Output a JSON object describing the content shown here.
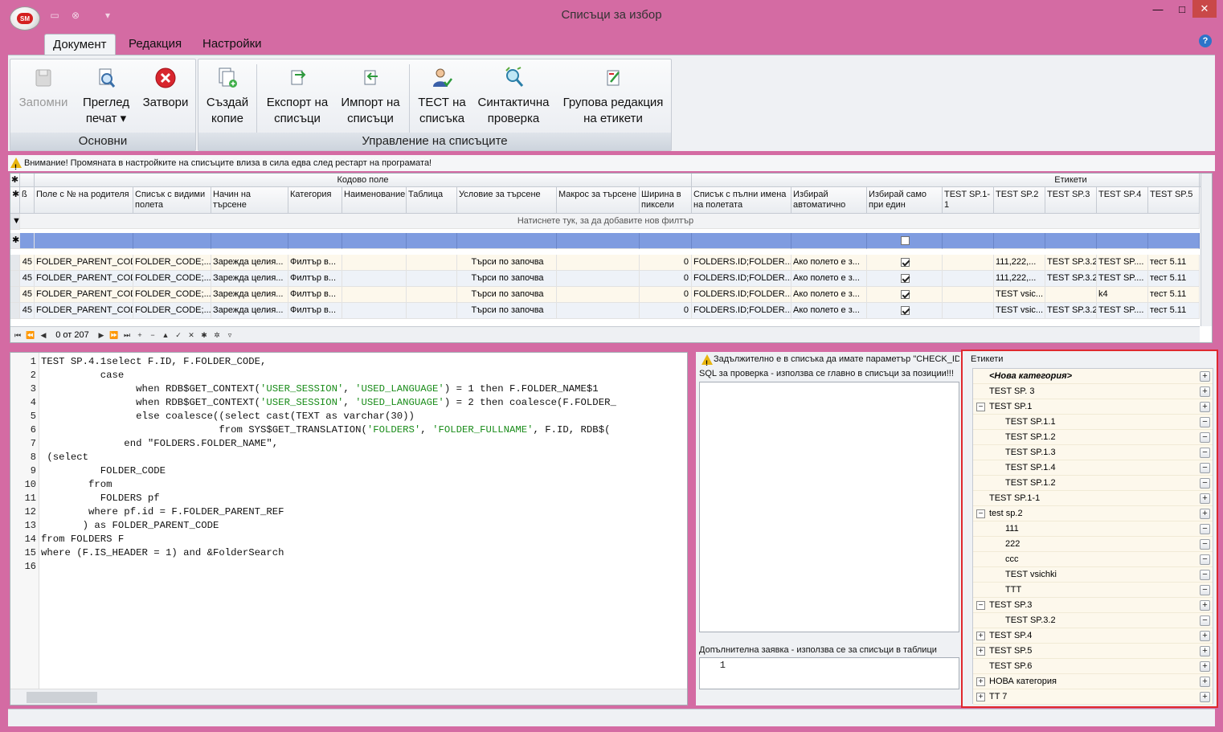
{
  "window": {
    "title": "Списъци за избор",
    "app_logo": "SM"
  },
  "ribbon_tabs": [
    "Документ",
    "Редакция",
    "Настройки"
  ],
  "ribbon": {
    "group1": {
      "label": "Основни",
      "buttons": [
        {
          "l1": "Запомни",
          "l2": "",
          "icon": "save-icon",
          "disabled": true
        },
        {
          "l1": "Преглед",
          "l2": "печат ▾",
          "icon": "print-preview-icon"
        },
        {
          "l1": "Затвори",
          "l2": "",
          "icon": "close-circle-icon"
        }
      ]
    },
    "group2": {
      "label": "Управление на списъците",
      "buttons": [
        {
          "l1": "Създай",
          "l2": "копие",
          "icon": "copy-icon"
        },
        {
          "l1": "Експорт на",
          "l2": "списъци",
          "icon": "export-icon"
        },
        {
          "l1": "Импорт на",
          "l2": "списъци",
          "icon": "import-icon"
        },
        {
          "l1": "ТЕСТ на",
          "l2": "списъка",
          "icon": "test-user-icon"
        },
        {
          "l1": "Синтактична",
          "l2": "проверка",
          "icon": "syntax-check-icon"
        },
        {
          "l1": "Групова редакция",
          "l2": "на етикети",
          "icon": "group-edit-icon"
        }
      ]
    }
  },
  "warning": "Внимание! Промяната в настройките на списъците влиза в сила едва след рестарт на програмата!",
  "grid": {
    "bands": {
      "code_field": "Кодово поле",
      "labels": "Етикети"
    },
    "columns": [
      "Поле с № на родителя",
      "Списък с видими полета",
      "Начин на търсене",
      "Категория",
      "Наименование",
      "Таблица",
      "Условие за търсене",
      "Макрос за търсене",
      "Ширина в пиксели",
      "Списък с пълни имена на полетата",
      "Избирай автоматично",
      "Избирай само при един елемент",
      "TEST SP.1-1",
      "TEST SP.2",
      "TEST SP.3",
      "TEST SP.4",
      "TEST SP.5"
    ],
    "filter_hint": "Натиснете тук, за да добавите нов филтър",
    "rows": [
      {
        "id": "45",
        "c": [
          "FOLDER_PARENT_CODE",
          "FOLDER_CODE;...",
          "Зарежда целия...",
          "Филтър в...",
          "",
          "",
          "Търси по започва",
          "",
          "0",
          "FOLDERS.ID;FOLDER...",
          "Ако полето е з...",
          "",
          "111,222,...",
          "TEST SP.3.2",
          "TEST SP....",
          "тест 5.11"
        ],
        "chk": true
      },
      {
        "id": "45",
        "c": [
          "FOLDER_PARENT_CODE",
          "FOLDER_CODE;...",
          "Зарежда целия...",
          "Филтър в...",
          "",
          "",
          "Търси по започва",
          "",
          "0",
          "FOLDERS.ID;FOLDER...",
          "Ако полето е з...",
          "",
          "111,222,...",
          "TEST SP.3.2",
          "TEST SP....",
          "тест 5.11"
        ],
        "chk": true
      },
      {
        "id": "45",
        "c": [
          "FOLDER_PARENT_CODE",
          "FOLDER_CODE;...",
          "Зарежда целия...",
          "Филтър в...",
          "",
          "",
          "Търси по започва",
          "",
          "0",
          "FOLDERS.ID;FOLDER...",
          "Ако полето е з...",
          "",
          "TEST vsic...",
          "",
          "k4",
          "тест 5.11"
        ],
        "chk": true
      },
      {
        "id": "45",
        "c": [
          "FOLDER_PARENT_CODE",
          "FOLDER_CODE;...",
          "Зарежда целия...",
          "Филтър в...",
          "",
          "",
          "Търси по започва",
          "",
          "0",
          "FOLDERS.ID;FOLDER...",
          "Ако полето е з...",
          "",
          "TEST vsic...",
          "TEST SP.3.2",
          "TEST SP....",
          "тест 5.11"
        ],
        "chk": true
      }
    ],
    "nav": {
      "count": "0 от 207"
    }
  },
  "editor": {
    "lines": [
      "TEST SP.4.1select F.ID, F.FOLDER_CODE,",
      "          case",
      "                when RDB$GET_CONTEXT('USER_SESSION', 'USED_LANGUAGE') = 1 then F.FOLDER_NAME$1",
      "                when RDB$GET_CONTEXT('USER_SESSION', 'USED_LANGUAGE') = 2 then coalesce(F.FOLDER_",
      "                else coalesce((select cast(TEXT as varchar(30))",
      "                              from SYS$GET_TRANSLATION('FOLDERS', 'FOLDER_FULLNAME', F.ID, RDB$(",
      "              end \"FOLDERS.FOLDER_NAME\",",
      " (select",
      "          FOLDER_CODE",
      "        from",
      "          FOLDERS pf",
      "        where pf.id = F.FOLDER_PARENT_REF",
      "       ) as FOLDER_PARENT_CODE",
      "from FOLDERS F",
      "where (F.IS_HEADER = 1) and &FolderSearch",
      ""
    ]
  },
  "mid": {
    "warn": "Задължително е в списъка да имате параметър \"CHECK_ID\"",
    "sql_check_label": "SQL за проверка - използва се главно в списъци за позиции!!!",
    "extra_query_label": "Допълнителна заявка - използва се за списъци в таблици",
    "extra_line": "1"
  },
  "tags": {
    "title": "Етикети",
    "nodes": [
      {
        "label": "<Нова категория>",
        "level": 0,
        "exp": "",
        "act": "+",
        "bold": true
      },
      {
        "label": "TEST SP. 3",
        "level": 0,
        "exp": "",
        "act": "+"
      },
      {
        "label": "TEST SP.1",
        "level": 0,
        "exp": "−",
        "act": "+"
      },
      {
        "label": "TEST SP.1.1",
        "level": 1,
        "exp": "",
        "act": "−"
      },
      {
        "label": "TEST SP.1.2",
        "level": 1,
        "exp": "",
        "act": "−"
      },
      {
        "label": "TEST SP.1.3",
        "level": 1,
        "exp": "",
        "act": "−"
      },
      {
        "label": "TEST SP.1.4",
        "level": 1,
        "exp": "",
        "act": "−"
      },
      {
        "label": "TEST SP.1.2",
        "level": 1,
        "exp": "",
        "act": "−"
      },
      {
        "label": "TEST SP.1-1",
        "level": 0,
        "exp": "",
        "act": "+"
      },
      {
        "label": "test sp.2",
        "level": 0,
        "exp": "−",
        "act": "+"
      },
      {
        "label": "111",
        "level": 1,
        "exp": "",
        "act": "−"
      },
      {
        "label": "222",
        "level": 1,
        "exp": "",
        "act": "−"
      },
      {
        "label": "ccc",
        "level": 1,
        "exp": "",
        "act": "−"
      },
      {
        "label": "TEST vsichki",
        "level": 1,
        "exp": "",
        "act": "−"
      },
      {
        "label": "TTT",
        "level": 1,
        "exp": "",
        "act": "−"
      },
      {
        "label": "TEST SP.3",
        "level": 0,
        "exp": "−",
        "act": "+"
      },
      {
        "label": "TEST SP.3.2",
        "level": 1,
        "exp": "",
        "act": "−"
      },
      {
        "label": "TEST SP.4",
        "level": 0,
        "exp": "+",
        "act": "+"
      },
      {
        "label": "TEST SP.5",
        "level": 0,
        "exp": "+",
        "act": "+"
      },
      {
        "label": "TEST SP.6",
        "level": 0,
        "exp": "",
        "act": "+"
      },
      {
        "label": "НОВА категория",
        "level": 0,
        "exp": "+",
        "act": "+"
      },
      {
        "label": "TT 7",
        "level": 0,
        "exp": "+",
        "act": "+"
      }
    ]
  },
  "colors": {
    "title_bar": "#d46ba3",
    "selected_row": "#7f9ce0",
    "tag_border": "#e0282e",
    "row_alt": "#fdf8ec"
  }
}
